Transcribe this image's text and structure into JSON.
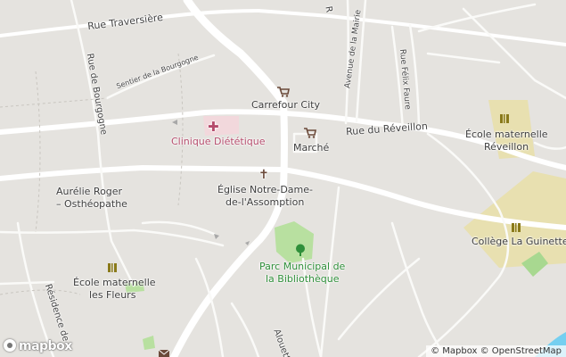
{
  "streets": {
    "traversiere": "Rue Traversière",
    "bourgogne": "Rue de Bourgogne",
    "sentier": "Sentier de la Bourgogne",
    "mairie": "Avenue de la Mairie",
    "felix_faure": "Rue Félix Faure",
    "reveillon": "Rue du Réveillon",
    "residence": "Résidence de",
    "alouettes": "Alouettes",
    "top_r": "R"
  },
  "pois": {
    "carrefour": "Carrefour City",
    "clinique": "Clinique Diététique",
    "marche": "Marché",
    "eglise_l1": "Église Notre-Dame-",
    "eglise_l2": "de-l'Assomption",
    "osteo_l1": "Aurélie Roger",
    "osteo_l2": "– Osthéopathe",
    "ecole_rev_l1": "École maternelle",
    "ecole_rev_l2": "Réveillon",
    "college": "Collège La Guinette",
    "parc_l1": "Parc Municipal de",
    "parc_l2": "la Bibliothèque",
    "ecole_fleurs_l1": "École maternelle",
    "ecole_fleurs_l2": "les Fleurs"
  },
  "attribution": "© Mapbox © OpenStreetMap",
  "logo_text": "mapbox",
  "colors": {
    "background": "#e5e3df",
    "road": "#ffffff",
    "school_area": "#e8e0b0",
    "park": "#b8e0a0",
    "clinic_area": "#f2d8dc",
    "pink": "#b54c6c",
    "green": "#2f8f3a"
  }
}
